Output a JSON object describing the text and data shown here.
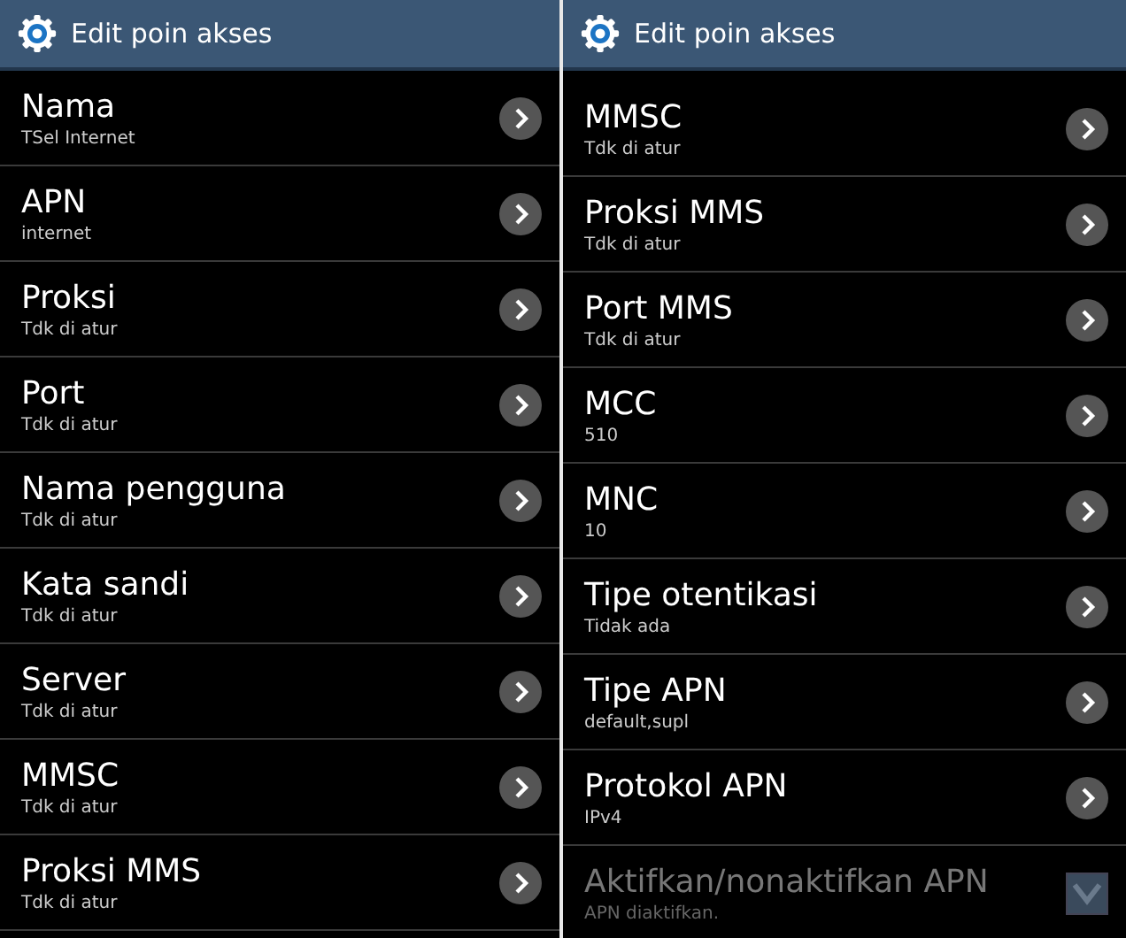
{
  "panels": [
    {
      "title": "Edit poin akses",
      "rows": [
        {
          "kind": "link",
          "label": "Nama",
          "value": "TSel Internet",
          "disabled": false
        },
        {
          "kind": "link",
          "label": "APN",
          "value": "internet",
          "disabled": false
        },
        {
          "kind": "link",
          "label": "Proksi",
          "value": "Tdk di atur",
          "disabled": false
        },
        {
          "kind": "link",
          "label": "Port",
          "value": "Tdk di atur",
          "disabled": false
        },
        {
          "kind": "link",
          "label": "Nama pengguna",
          "value": "Tdk di atur",
          "disabled": false
        },
        {
          "kind": "link",
          "label": "Kata sandi",
          "value": "Tdk di atur",
          "disabled": false
        },
        {
          "kind": "link",
          "label": "Server",
          "value": "Tdk di atur",
          "disabled": false
        },
        {
          "kind": "link",
          "label": "MMSC",
          "value": "Tdk di atur",
          "disabled": false
        },
        {
          "kind": "link",
          "label": "Proksi MMS",
          "value": "Tdk di atur",
          "disabled": false
        }
      ]
    },
    {
      "title": "Edit poin akses",
      "rows": [
        {
          "kind": "link",
          "label": "MMSC",
          "value": "Tdk di atur",
          "disabled": false
        },
        {
          "kind": "link",
          "label": "Proksi MMS",
          "value": "Tdk di atur",
          "disabled": false
        },
        {
          "kind": "link",
          "label": "Port MMS",
          "value": "Tdk di atur",
          "disabled": false
        },
        {
          "kind": "link",
          "label": "MCC",
          "value": "510",
          "disabled": false
        },
        {
          "kind": "link",
          "label": "MNC",
          "value": "10",
          "disabled": false
        },
        {
          "kind": "link",
          "label": "Tipe otentikasi",
          "value": "Tidak ada",
          "disabled": false
        },
        {
          "kind": "link",
          "label": "Tipe APN",
          "value": "default,supl",
          "disabled": false
        },
        {
          "kind": "link",
          "label": "Protokol APN",
          "value": "IPv4",
          "disabled": false
        },
        {
          "kind": "checkbox",
          "label": "Aktifkan/nonaktifkan APN",
          "value": "APN diaktifkan.",
          "disabled": true,
          "checked": true
        }
      ]
    }
  ]
}
